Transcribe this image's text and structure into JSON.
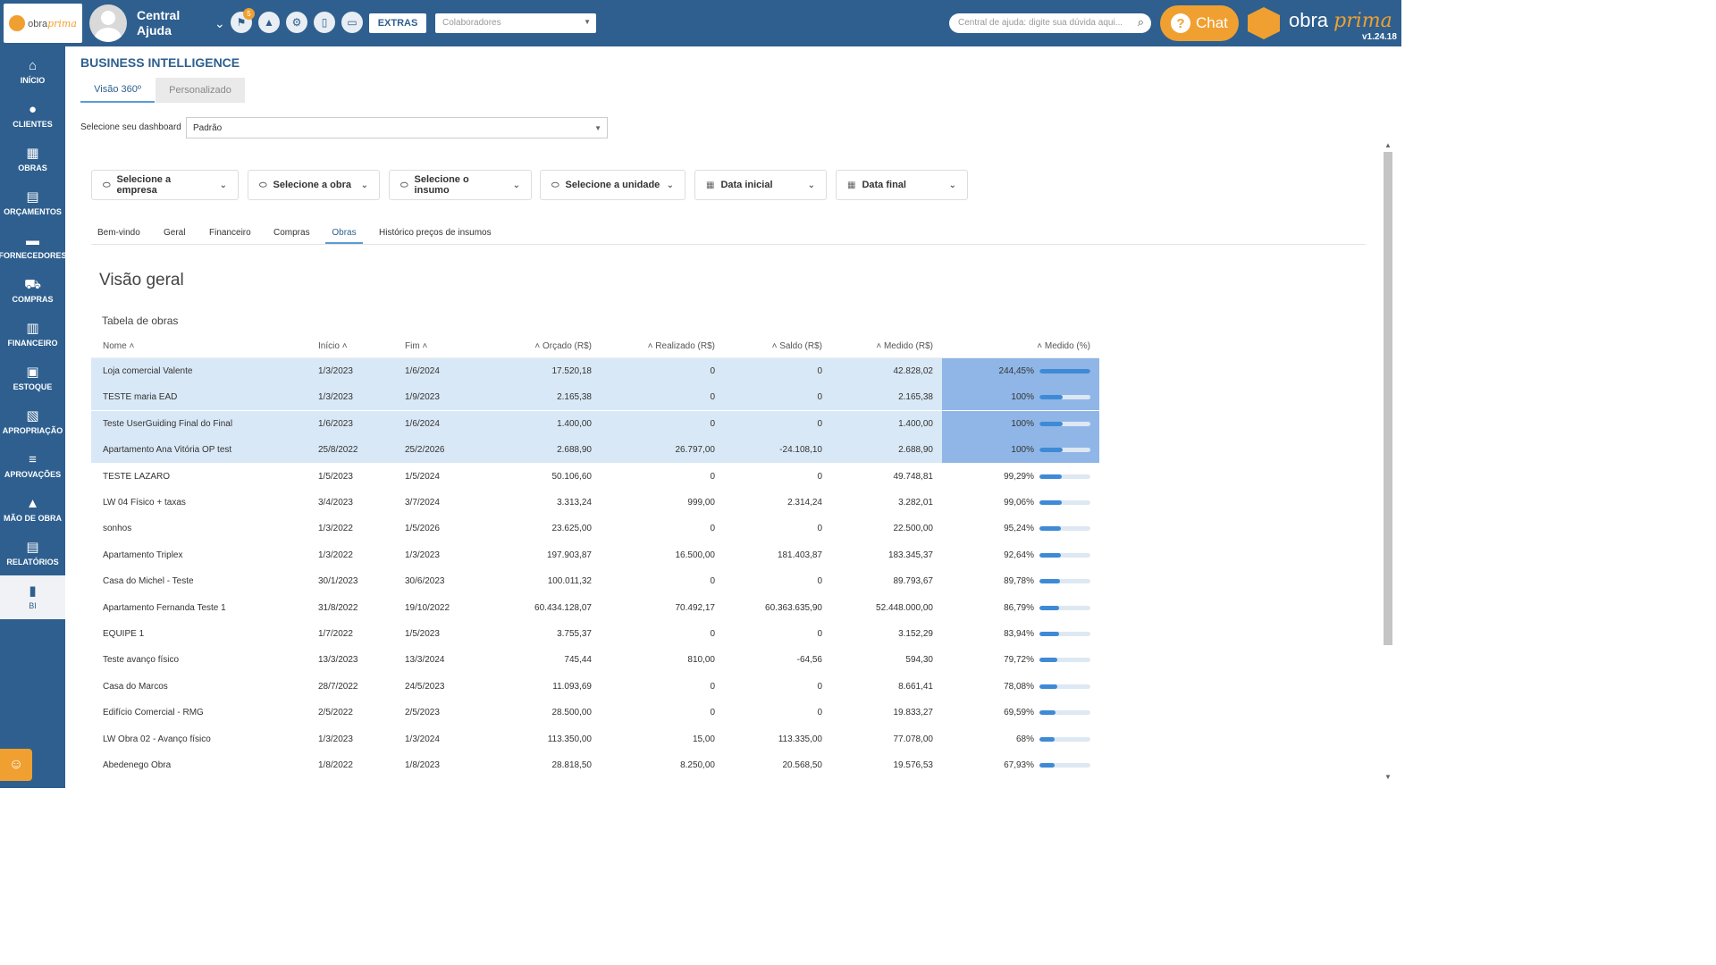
{
  "header": {
    "logo_text": "obra",
    "logo_script": "prima",
    "central": "Central Ajuda",
    "notif_count": "5",
    "extras_label": "EXTRAS",
    "colab_placeholder": "Colaboradores",
    "help_placeholder": "Central de ajuda: digite sua dúvida aqui...",
    "chat_label": "Chat",
    "brand_a": "obra",
    "brand_b": "prima",
    "version": "v1.24.18"
  },
  "sidebar": {
    "items": [
      {
        "label": "INÍCIO",
        "icon": "⌂"
      },
      {
        "label": "CLIENTES",
        "icon": "●"
      },
      {
        "label": "OBRAS",
        "icon": "▦"
      },
      {
        "label": "ORÇAMENTOS",
        "icon": "▤"
      },
      {
        "label": "FORNECEDORES",
        "icon": "▬"
      },
      {
        "label": "COMPRAS",
        "icon": "⛟"
      },
      {
        "label": "FINANCEIRO",
        "icon": "▥"
      },
      {
        "label": "ESTOQUE",
        "icon": "▣"
      },
      {
        "label": "APROPRIAÇÃO",
        "icon": "▧"
      },
      {
        "label": "APROVAÇÕES",
        "icon": "≡"
      },
      {
        "label": "MÃO DE OBRA",
        "icon": "▲"
      },
      {
        "label": "RELATÓRIOS",
        "icon": "▤"
      },
      {
        "label": "BI",
        "icon": "▮"
      }
    ]
  },
  "page": {
    "title": "BUSINESS INTELLIGENCE",
    "tab_360": "Visão 360º",
    "tab_personalizado": "Personalizado",
    "dash_label": "Selecione seu dashboard",
    "dash_value": "Padrão"
  },
  "filters": {
    "empresa": "Selecione a empresa",
    "obra": "Selecione a obra",
    "insumo": "Selecione o insumo",
    "unidade": "Selecione a unidade",
    "data_inicial": "Data inicial",
    "data_final": "Data final"
  },
  "subtabs": {
    "bemvindo": "Bem-vindo",
    "geral": "Geral",
    "financeiro": "Financeiro",
    "compras": "Compras",
    "obras": "Obras",
    "historico": "Histórico preços de insumos"
  },
  "overview": {
    "title": "Visão geral",
    "table_title": "Tabela de obras"
  },
  "table": {
    "headers": {
      "nome": "Nome",
      "inicio": "Início",
      "fim": "Fim",
      "orcado": "Orçado (R$)",
      "realizado": "Realizado (R$)",
      "saldo": "Saldo (R$)",
      "medido": "Medido (R$)",
      "medido_pct": "Medido (%)"
    },
    "rows": [
      {
        "nome": "Loja comercial Valente",
        "inicio": "1/3/2023",
        "fim": "1/6/2024",
        "orcado": "17.520,18",
        "realizado": "0",
        "saldo": "0",
        "medido": "42.828,02",
        "pct": "244,45%",
        "frac": 2.4445,
        "hl": true
      },
      {
        "nome": "TESTE maria EAD",
        "inicio": "1/3/2023",
        "fim": "1/9/2023",
        "orcado": "2.165,38",
        "realizado": "0",
        "saldo": "0",
        "medido": "2.165,38",
        "pct": "100%",
        "frac": 1.0,
        "hl": true
      },
      {
        "nome": "Teste UserGuiding Final do Final",
        "inicio": "1/6/2023",
        "fim": "1/6/2024",
        "orcado": "1.400,00",
        "realizado": "0",
        "saldo": "0",
        "medido": "1.400,00",
        "pct": "100%",
        "frac": 1.0,
        "hl": true
      },
      {
        "nome": "Apartamento Ana Vitória OP test",
        "inicio": "25/8/2022",
        "fim": "25/2/2026",
        "orcado": "2.688,90",
        "realizado": "26.797,00",
        "saldo": "-24.108,10",
        "medido": "2.688,90",
        "pct": "100%",
        "frac": 1.0,
        "hl": true
      },
      {
        "nome": "TESTE LAZARO",
        "inicio": "1/5/2023",
        "fim": "1/5/2024",
        "orcado": "50.106,60",
        "realizado": "0",
        "saldo": "0",
        "medido": "49.748,81",
        "pct": "99,29%",
        "frac": 0.9929,
        "hl": false
      },
      {
        "nome": "LW 04 Físico + taxas",
        "inicio": "3/4/2023",
        "fim": "3/7/2024",
        "orcado": "3.313,24",
        "realizado": "999,00",
        "saldo": "2.314,24",
        "medido": "3.282,01",
        "pct": "99,06%",
        "frac": 0.9906,
        "hl": false
      },
      {
        "nome": "sonhos",
        "inicio": "1/3/2022",
        "fim": "1/5/2026",
        "orcado": "23.625,00",
        "realizado": "0",
        "saldo": "0",
        "medido": "22.500,00",
        "pct": "95,24%",
        "frac": 0.9524,
        "hl": false
      },
      {
        "nome": "Apartamento Triplex",
        "inicio": "1/3/2022",
        "fim": "1/3/2023",
        "orcado": "197.903,87",
        "realizado": "16.500,00",
        "saldo": "181.403,87",
        "medido": "183.345,37",
        "pct": "92,64%",
        "frac": 0.9264,
        "hl": false
      },
      {
        "nome": "Casa do Michel - Teste",
        "inicio": "30/1/2023",
        "fim": "30/6/2023",
        "orcado": "100.011,32",
        "realizado": "0",
        "saldo": "0",
        "medido": "89.793,67",
        "pct": "89,78%",
        "frac": 0.8978,
        "hl": false
      },
      {
        "nome": "Apartamento Fernanda Teste 1",
        "inicio": "31/8/2022",
        "fim": "19/10/2022",
        "orcado": "60.434.128,07",
        "realizado": "70.492,17",
        "saldo": "60.363.635,90",
        "medido": "52.448.000,00",
        "pct": "86,79%",
        "frac": 0.8679,
        "hl": false
      },
      {
        "nome": "EQUIPE 1",
        "inicio": "1/7/2022",
        "fim": "1/5/2023",
        "orcado": "3.755,37",
        "realizado": "0",
        "saldo": "0",
        "medido": "3.152,29",
        "pct": "83,94%",
        "frac": 0.8394,
        "hl": false
      },
      {
        "nome": "Teste avanço físico",
        "inicio": "13/3/2023",
        "fim": "13/3/2024",
        "orcado": "745,44",
        "realizado": "810,00",
        "saldo": "-64,56",
        "medido": "594,30",
        "pct": "79,72%",
        "frac": 0.7972,
        "hl": false
      },
      {
        "nome": "Casa do Marcos",
        "inicio": "28/7/2022",
        "fim": "24/5/2023",
        "orcado": "11.093,69",
        "realizado": "0",
        "saldo": "0",
        "medido": "8.661,41",
        "pct": "78,08%",
        "frac": 0.7808,
        "hl": false
      },
      {
        "nome": "Edifício Comercial - RMG",
        "inicio": "2/5/2022",
        "fim": "2/5/2023",
        "orcado": "28.500,00",
        "realizado": "0",
        "saldo": "0",
        "medido": "19.833,27",
        "pct": "69,59%",
        "frac": 0.6959,
        "hl": false
      },
      {
        "nome": "LW Obra 02 - Avanço físico",
        "inicio": "1/3/2023",
        "fim": "1/3/2024",
        "orcado": "113.350,00",
        "realizado": "15,00",
        "saldo": "113.335,00",
        "medido": "77.078,00",
        "pct": "68%",
        "frac": 0.68,
        "hl": false
      },
      {
        "nome": "Abedenego Obra",
        "inicio": "1/8/2022",
        "fim": "1/8/2023",
        "orcado": "28.818,50",
        "realizado": "8.250,00",
        "saldo": "20.568,50",
        "medido": "19.576,53",
        "pct": "67,93%",
        "frac": 0.6793,
        "hl": false
      }
    ]
  },
  "colors": {
    "primary": "#2e5f8f",
    "accent": "#f0a030",
    "highlight": "#d9e8f6",
    "bar": "#3f8ad6"
  }
}
